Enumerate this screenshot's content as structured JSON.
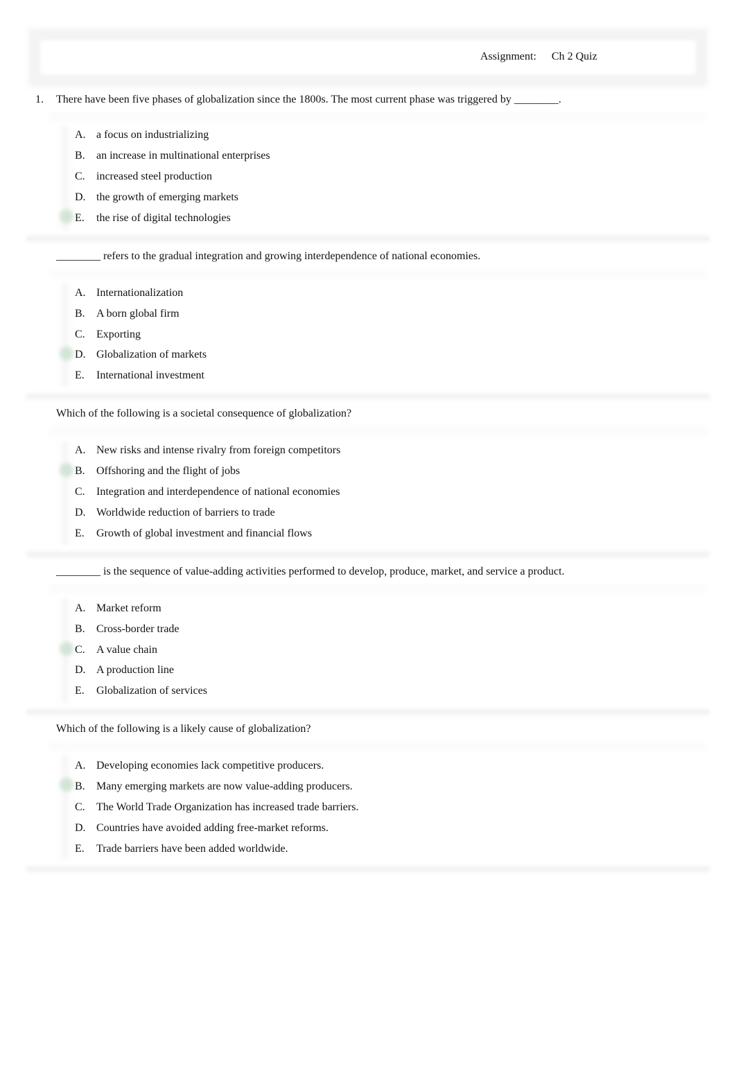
{
  "header": {
    "assignment_label": "Assignment:",
    "assignment_value": "Ch 2 Quiz"
  },
  "questions": [
    {
      "number": "1.",
      "text": "There have been five phases of globalization since the 1800s. The most current phase was triggered by ________.",
      "correct": "E",
      "options": [
        {
          "letter": "A.",
          "text": "a focus on industrializing"
        },
        {
          "letter": "B.",
          "text": "an increase in multinational enterprises"
        },
        {
          "letter": "C.",
          "text": "increased steel production"
        },
        {
          "letter": "D.",
          "text": "the growth of emerging markets"
        },
        {
          "letter": "E.",
          "text": "the rise of digital technologies"
        }
      ]
    },
    {
      "number": "",
      "text": "________ refers to the gradual integration and growing interdependence of national economies.",
      "correct": "D",
      "options": [
        {
          "letter": "A.",
          "text": "Internationalization"
        },
        {
          "letter": "B.",
          "text": "A born global firm"
        },
        {
          "letter": "C.",
          "text": "Exporting"
        },
        {
          "letter": "D.",
          "text": "Globalization of markets"
        },
        {
          "letter": "E.",
          "text": "International investment"
        }
      ]
    },
    {
      "number": "",
      "text": "Which of the following is a societal consequence of globalization?",
      "correct": "B",
      "options": [
        {
          "letter": "A.",
          "text": "New risks and intense rivalry from foreign competitors"
        },
        {
          "letter": "B.",
          "text": "Offshoring and the flight of jobs"
        },
        {
          "letter": "C.",
          "text": "Integration and interdependence of national economies"
        },
        {
          "letter": "D.",
          "text": "Worldwide reduction of barriers to trade"
        },
        {
          "letter": "E.",
          "text": "Growth of global investment and financial flows"
        }
      ]
    },
    {
      "number": "",
      "text": "________ is the sequence of value-adding activities performed to develop, produce, market, and service a product.",
      "correct": "C",
      "options": [
        {
          "letter": "A.",
          "text": "Market reform"
        },
        {
          "letter": "B.",
          "text": "Cross-border trade"
        },
        {
          "letter": "C.",
          "text": "A value chain"
        },
        {
          "letter": "D.",
          "text": "A production line"
        },
        {
          "letter": "E.",
          "text": "Globalization of services"
        }
      ]
    },
    {
      "number": "",
      "text": "Which of the following is a likely cause of globalization?",
      "correct": "B",
      "options": [
        {
          "letter": "A.",
          "text": "Developing economies lack competitive producers."
        },
        {
          "letter": "B.",
          "text": "Many emerging markets are now value-adding producers."
        },
        {
          "letter": "C.",
          "text": "The World Trade Organization has increased trade barriers."
        },
        {
          "letter": "D.",
          "text": "Countries have avoided adding free-market reforms."
        },
        {
          "letter": "E.",
          "text": "Trade barriers have been added worldwide."
        }
      ]
    }
  ]
}
